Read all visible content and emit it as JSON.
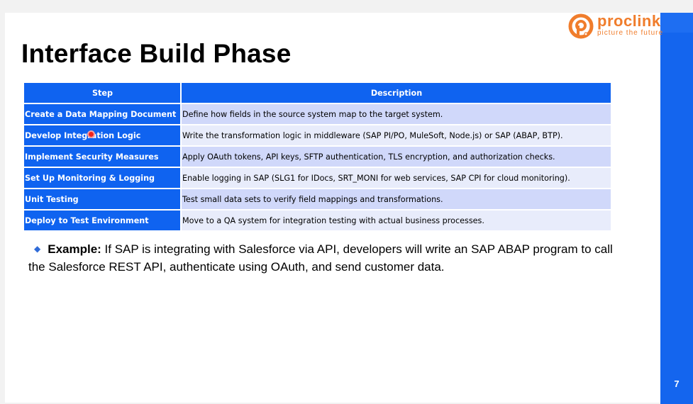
{
  "slide": {
    "title": "Interface Build Phase",
    "page_number": "7"
  },
  "logo": {
    "name": "proclink",
    "tagline": "picture the future"
  },
  "table": {
    "headers": [
      "Step",
      "Description"
    ],
    "rows": [
      {
        "step": "Create a Data Mapping Document",
        "description": "Define how fields in the source system map to the target system."
      },
      {
        "step": "Develop Integration Logic",
        "description": "Write the transformation logic in middleware (SAP PI/PO, MuleSoft, Node.js) or SAP (ABAP, BTP)."
      },
      {
        "step": "Implement Security Measures",
        "description": "Apply OAuth tokens, API keys, SFTP authentication, TLS encryption, and authorization checks."
      },
      {
        "step": "Set Up Monitoring & Logging",
        "description": "Enable logging in SAP (SLG1 for IDocs, SRT_MONI for web services, SAP CPI for cloud monitoring)."
      },
      {
        "step": "Unit Testing",
        "description": "Test small data sets to verify field mappings and transformations."
      },
      {
        "step": "Deploy to Test Environment",
        "description": "Move to a QA system for integration testing with actual business processes."
      }
    ]
  },
  "example": {
    "bullet": "◆",
    "label": "Example:",
    "text": " If SAP is integrating with Salesforce via API, developers will write an SAP ABAP program to call the Salesforce REST API, authenticate using OAuth, and send customer data."
  },
  "colors": {
    "accent": "#1465ee",
    "brand": "#f07d2c",
    "header_bg": "#0f63f0",
    "row_odd": "#d0d8fa",
    "row_even": "#e8ecfb"
  }
}
